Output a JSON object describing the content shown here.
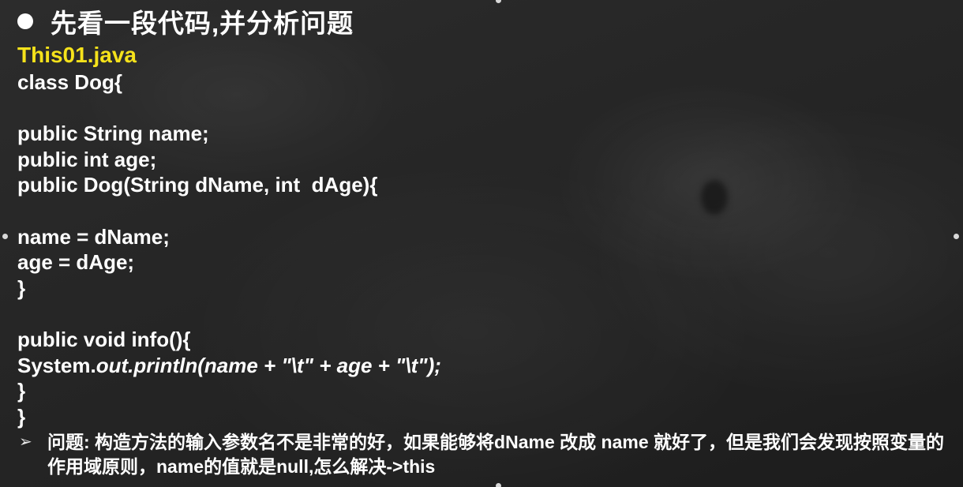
{
  "slide": {
    "title": "先看一段代码,并分析问题",
    "filename": "This01.java",
    "code_lines": [
      "class Dog{",
      "",
      "public String name;",
      "public int age;",
      "public Dog(String dName, int  dAge){",
      "",
      "name = dName;",
      "age = dAge;",
      "}",
      "",
      "public void info(){",
      "System.out.println(name + \"\\t\" + age + \"\\t\");",
      "}",
      "}"
    ],
    "note_bullet": "➢",
    "note": "问题: 构造方法的输入参数名不是非常的好，如果能够将dName 改成  name 就好了，但是我们会发现按照变量的作用域原则，name的值就是null,怎么解决->this"
  },
  "colors": {
    "background": "#262626",
    "text": "#ffffff",
    "filename": "#f5e21b"
  }
}
